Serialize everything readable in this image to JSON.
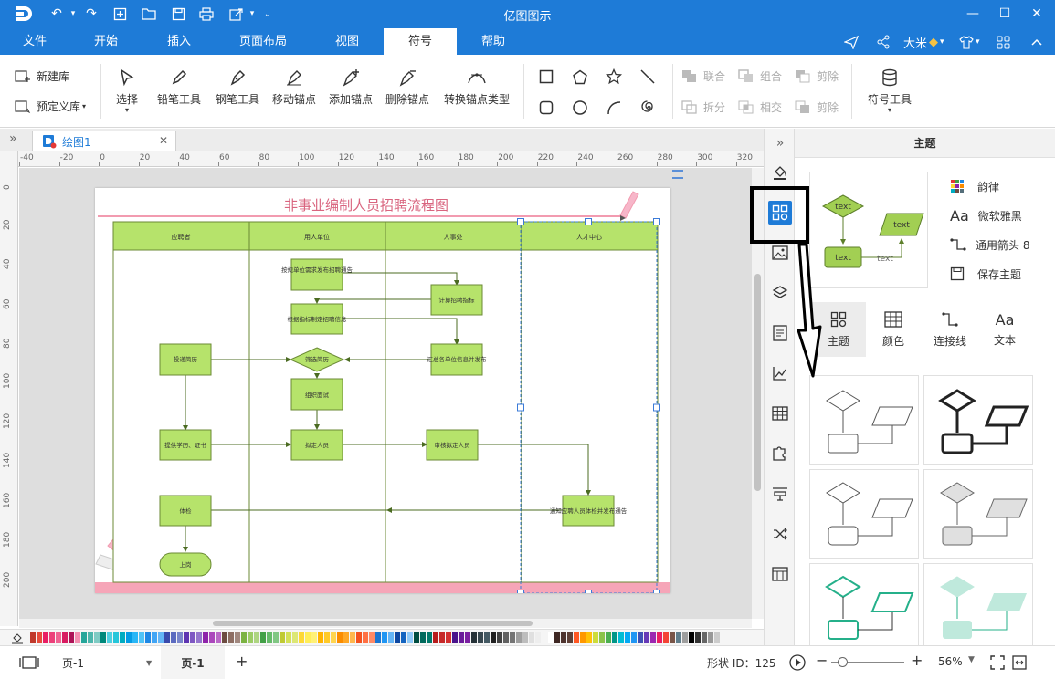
{
  "app": {
    "title": "亿图图示"
  },
  "menu": {
    "tabs": [
      "文件",
      "开始",
      "插入",
      "页面布局",
      "视图",
      "符号",
      "帮助"
    ],
    "active": "符号",
    "user": "大米"
  },
  "ribbon": {
    "new_lib": "新建库",
    "predef_lib": "预定义库",
    "select": "选择",
    "pencil": "铅笔工具",
    "pen": "钢笔工具",
    "move_anchor": "移动锚点",
    "add_anchor": "添加锚点",
    "delete_anchor": "删除锚点",
    "convert_anchor": "转换锚点类型",
    "union": "联合",
    "combine": "组合",
    "subtract": "剪除",
    "split": "拆分",
    "intersect": "相交",
    "subtract2": "剪除",
    "symbol_tool": "符号工具"
  },
  "doc": {
    "tab": "绘图1"
  },
  "rulers": {
    "h": [
      "-40",
      "-20",
      "0",
      "20",
      "40",
      "60",
      "80",
      "100",
      "120",
      "140",
      "160",
      "180",
      "200",
      "220",
      "240",
      "260",
      "280",
      "300",
      "320"
    ],
    "v": [
      "0",
      "20",
      "40",
      "60",
      "80",
      "100",
      "120",
      "140",
      "160",
      "180",
      "200"
    ]
  },
  "diagram": {
    "title": "非事业编制人员招聘流程图",
    "lanes": [
      "应聘者",
      "用人单位",
      "人事处",
      "人才中心"
    ],
    "nodes": {
      "n1": "按规单位需求发布招聘通告",
      "n2": "计算招聘指标",
      "n3": "根据指标制定招聘信息",
      "n4": "投递简历",
      "n5": "筛选简历",
      "n6": "汇总各单位信息并发布",
      "n7": "组织面试",
      "n8": "提供学历、证书",
      "n9": "拟定人员",
      "n10": "审核拟定人员",
      "n11": "体检",
      "n12": "通知应聘人员体检并发布通告",
      "n13": "上岗"
    }
  },
  "panel": {
    "title": "主题",
    "preview": {
      "label": "text"
    },
    "props": [
      "韵律",
      "微软雅黑",
      "通用箭头 8",
      "保存主题"
    ],
    "tabs": [
      "主题",
      "颜色",
      "连接线",
      "文本"
    ]
  },
  "status": {
    "page_sel": "页-1",
    "page_tab": "页-1",
    "add": "+",
    "shape_id": "形状 ID：125",
    "zoom": "56%"
  },
  "palette": [
    "#c0392b",
    "#e74c3c",
    "#e91e63",
    "#ec407a",
    "#f06292",
    "#d81b60",
    "#ad1457",
    "#f48fb1",
    "#26a69a",
    "#4db6ac",
    "#80cbc4",
    "#00897b",
    "#4dd0e1",
    "#26c6da",
    "#00acc1",
    "#039be5",
    "#29b6f6",
    "#4fc3f7",
    "#1e88e5",
    "#42a5f5",
    "#64b5f6",
    "#3949ab",
    "#5c6bc0",
    "#7986cb",
    "#5e35b1",
    "#7e57c2",
    "#9575cd",
    "#8e24aa",
    "#ab47bc",
    "#ba68c8",
    "#6d4c41",
    "#8d6e63",
    "#a1887f",
    "#7cb342",
    "#9ccc65",
    "#aed581",
    "#43a047",
    "#66bb6a",
    "#81c784",
    "#c0ca33",
    "#d4e157",
    "#dce775",
    "#fdd835",
    "#ffee58",
    "#fff176",
    "#ffb300",
    "#ffca28",
    "#ffd54f",
    "#fb8c00",
    "#ffa726",
    "#ffb74d",
    "#f4511e",
    "#ff7043",
    "#ff8a65",
    "#1976d2",
    "#2196f3",
    "#64b5f6",
    "#0d47a1",
    "#1565c0",
    "#90caf9",
    "#004d40",
    "#00695c",
    "#00796b",
    "#b71c1c",
    "#c62828",
    "#d32f2f",
    "#4a148c",
    "#6a1b9a",
    "#7b1fa2",
    "#263238",
    "#37474f",
    "#455a64",
    "#212121",
    "#424242",
    "#616161",
    "#757575",
    "#9e9e9e",
    "#bdbdbd",
    "#e0e0e0",
    "#eeeeee",
    "#f5f5f5",
    "#ffffff",
    "#3e2723",
    "#4e342e",
    "#5d4037",
    "#ff5722",
    "#ff9800",
    "#ffc107",
    "#cddc39",
    "#8bc34a",
    "#4caf50",
    "#009688",
    "#00bcd4",
    "#03a9f4",
    "#2196f3",
    "#3f51b5",
    "#673ab7",
    "#9c27b0",
    "#e91e63",
    "#f44336",
    "#795548",
    "#607d8b",
    "#9e9e9e",
    "#000000",
    "#333333",
    "#666666",
    "#999999",
    "#cccccc"
  ]
}
